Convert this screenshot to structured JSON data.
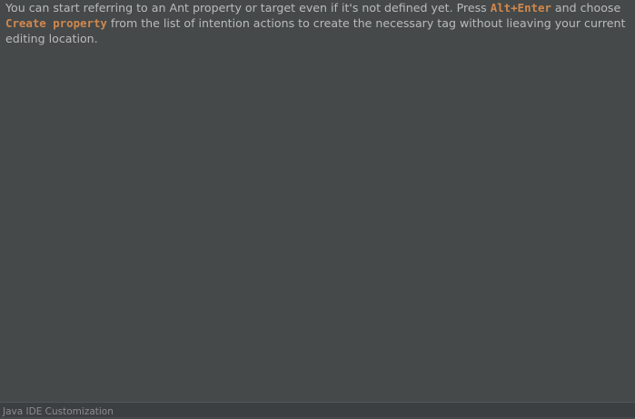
{
  "tip": {
    "part1": "You can start referring to an Ant property or target even if it's not defined yet. Press ",
    "shortcut": "Alt+Enter",
    "part2": " and choose ",
    "action": "Create property",
    "part3": " from the list of intention actions to create the necessary tag without lieaving your current editing location."
  },
  "footer": {
    "label": "Java IDE Customization"
  },
  "colors": {
    "background": "#45494a",
    "text": "#bbbbbb",
    "accent": "#d1884d",
    "footer_background": "#3c3f41"
  }
}
